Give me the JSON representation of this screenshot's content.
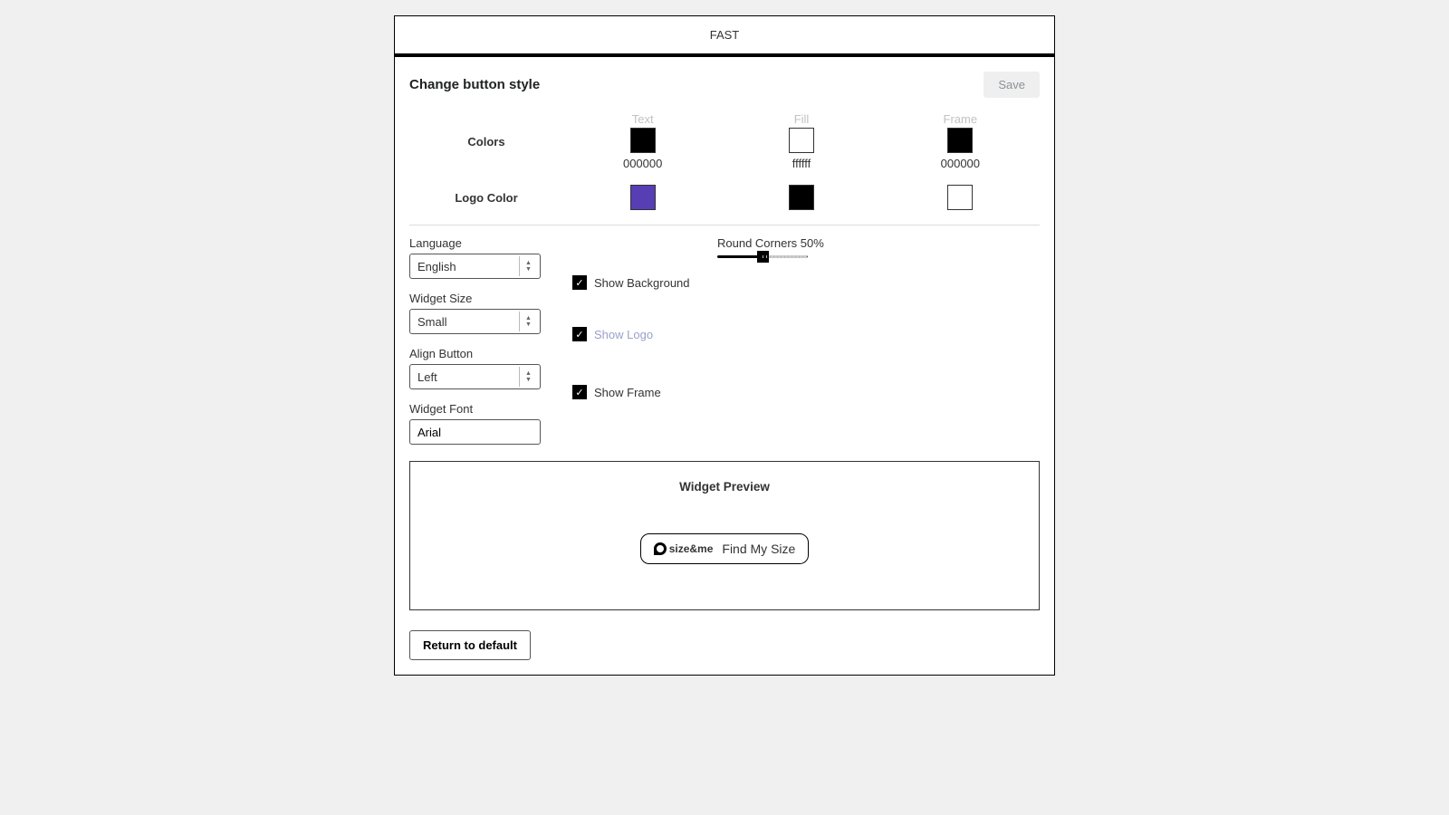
{
  "tab": "FAST",
  "header": {
    "title": "Change button style",
    "save": "Save"
  },
  "colors": {
    "row_label": "Colors",
    "text": {
      "heading": "Text",
      "hex": "000000",
      "swatch": "#000000"
    },
    "fill": {
      "heading": "Fill",
      "hex": "ffffff",
      "swatch": "#ffffff"
    },
    "frame": {
      "heading": "Frame",
      "hex": "000000",
      "swatch": "#000000"
    }
  },
  "logo_colors": {
    "row_label": "Logo Color",
    "a": "#573eb5",
    "b": "#000000",
    "c": "#ffffff"
  },
  "fields": {
    "language": {
      "label": "Language",
      "value": "English"
    },
    "widget_size": {
      "label": "Widget Size",
      "value": "Small"
    },
    "align": {
      "label": "Align Button",
      "value": "Left"
    },
    "font": {
      "label": "Widget Font",
      "value": "Arial"
    }
  },
  "checks": {
    "show_bg": "Show Background",
    "show_logo": "Show Logo",
    "show_frame": "Show Frame"
  },
  "round": {
    "label": "Round Corners 50%"
  },
  "preview": {
    "title": "Widget Preview",
    "brand": "size&me",
    "cta": "Find My Size"
  },
  "return_btn": "Return to default"
}
